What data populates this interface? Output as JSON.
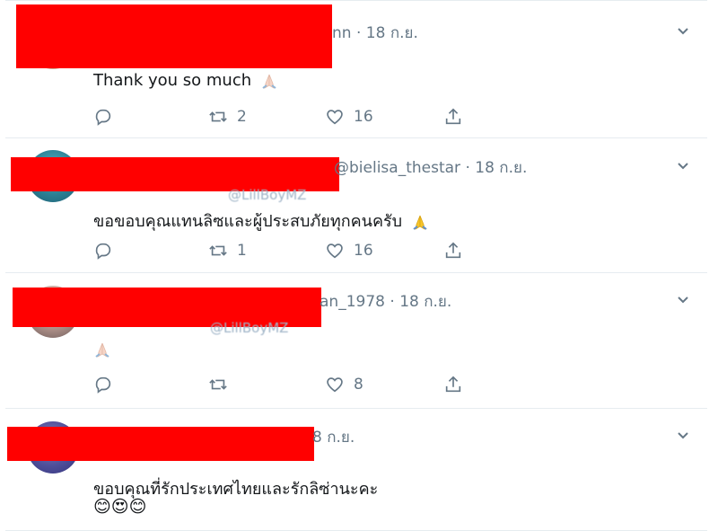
{
  "tweets": [
    {
      "handle_tail": "nn",
      "sep": "·",
      "date": "18 ก.ย.",
      "text": "Thank you so much",
      "emoji": "pray-light",
      "reply_count": "",
      "retweet_count": "2",
      "like_count": "16"
    },
    {
      "handle_tail": "@bielisa_thestar",
      "sep": "·",
      "date": "18 ก.ย.",
      "reply_to_hint": "@LillBoyMZ",
      "text": "ขอขอบคุณแทนลิซและผู้ประสบภัยทุกคนครับ",
      "emoji": "pray-yellow",
      "reply_count": "",
      "retweet_count": "1",
      "like_count": "16"
    },
    {
      "handle_tail": "an_1978",
      "sep": "·",
      "date": "18 ก.ย.",
      "reply_to_hint": "@LillBoyMZ",
      "text": "",
      "emoji": "pray-light",
      "reply_count": "",
      "retweet_count": "",
      "like_count": "8"
    },
    {
      "handle_tail": "8 ก.ย.",
      "sep": "",
      "date": "",
      "text": "ขอบคุณที่รักประเทศไทยและรักลิซ่านะคะ",
      "emoji_line": "😊😍😊",
      "reply_count": "",
      "retweet_count": "",
      "like_count": ""
    }
  ],
  "icons": {
    "reply": "reply-icon",
    "retweet": "retweet-icon",
    "like": "heart-icon",
    "share": "share-icon",
    "menu": "chevron-down-icon"
  },
  "colors": {
    "redaction": "#ff0000",
    "muted": "#657786",
    "text": "#14171a",
    "border": "#e6ecf0"
  }
}
